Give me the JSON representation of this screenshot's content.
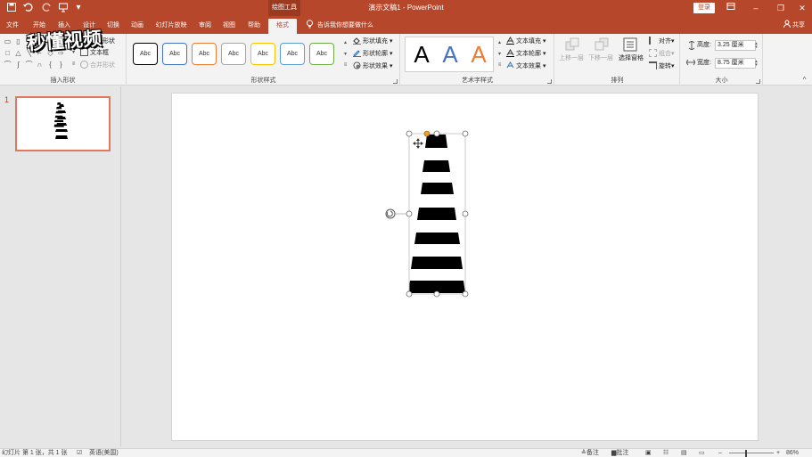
{
  "titlebar": {
    "doc_title": "演示文稿1 - PowerPoint",
    "contextual_tab": "绘图工具",
    "login_label": "登录",
    "save_icon": "save-icon",
    "undo_icon": "undo-icon",
    "redo_icon": "redo-icon",
    "present_icon": "start-from-beginning-icon",
    "customize_icon": "customize-qat-icon"
  },
  "tabs": [
    "文件",
    "开始",
    "插入",
    "设计",
    "切换",
    "动画",
    "幻灯片放映",
    "审阅",
    "视图",
    "帮助",
    "格式"
  ],
  "active_tab": "格式",
  "tell_me": "告诉我你想要做什么",
  "share_label": "共享",
  "watermark": "秒懂视频",
  "ribbon": {
    "insert_shapes": {
      "label": "插入形状",
      "edit_shape": "编辑形状",
      "text_box": "文本框",
      "merge_shapes": "合并形状"
    },
    "shape_styles": {
      "label": "形状样式",
      "swatch_text": "Abc",
      "swatch_colors": [
        "#000000",
        "#4472c4",
        "#ed7d31",
        "#a5a5a5",
        "#ffc000",
        "#5b9bd5",
        "#70ad47"
      ],
      "fill": "形状填充",
      "outline": "形状轮廓",
      "effects": "形状效果"
    },
    "wordart_styles": {
      "label": "艺术字样式",
      "samples": [
        {
          "text": "A",
          "color": "#000000"
        },
        {
          "text": "A",
          "color": "#4472c4"
        },
        {
          "text": "A",
          "color": "#ed7d31"
        }
      ],
      "text_fill": "文本填充",
      "text_outline": "文本轮廓",
      "text_effects": "文本效果"
    },
    "arrange": {
      "label": "排列",
      "bring_forward": "上移一层",
      "send_backward": "下移一层",
      "selection_pane": "选择窗格",
      "align": "对齐",
      "group": "组合",
      "rotate": "旋转"
    },
    "size": {
      "label": "大小",
      "height_label": "高度:",
      "height_value": "3.25 厘米",
      "width_label": "宽度:",
      "width_value": "8.75 厘米"
    }
  },
  "thumbnail": {
    "slide_number": "1"
  },
  "status": {
    "slide_info": "幻灯片 第 1 张，共 1 张",
    "language": "英语(美国)",
    "notes": "备注",
    "comments": "批注",
    "zoom": "86%"
  },
  "colors": {
    "accent": "#b7472a",
    "selection": "#d0d0d0",
    "adjust_handle": "#f0a020"
  }
}
